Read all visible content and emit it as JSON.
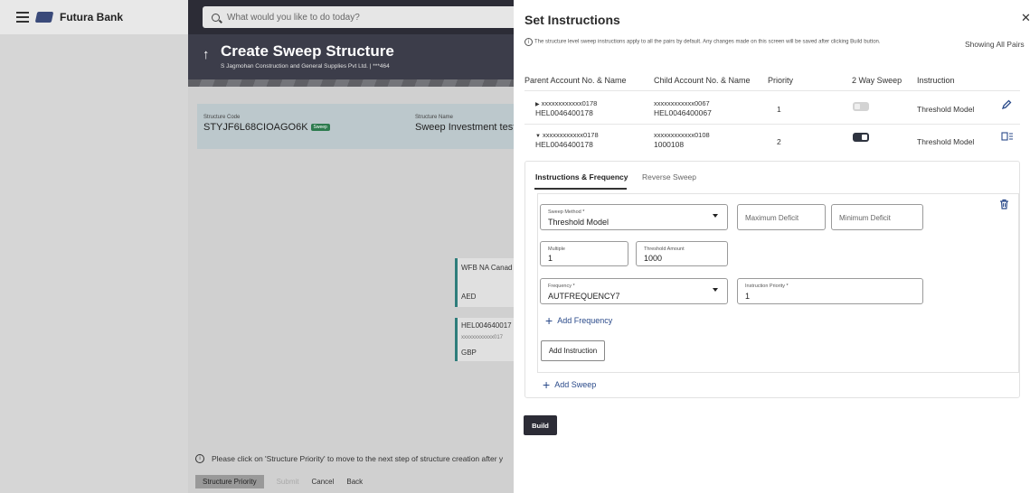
{
  "header": {
    "brand": "Futura Bank",
    "search_placeholder": "What would you like to do today?"
  },
  "page": {
    "title": "Create Sweep Structure",
    "subtitle": "S Jagmohan Construction and General Supplies Pvt Ltd. | ***464",
    "structure_code_label": "Structure Code",
    "structure_code": "STYJF6L68CIOAGO6K",
    "structure_code_badge": "Sweep",
    "structure_name_label": "Structure Name",
    "structure_name": "Sweep Investment test",
    "nodes": [
      {
        "line1": "WFB NA Canad",
        "line2": "AED"
      },
      {
        "line1": "HEL004640017",
        "line2": "xxxxxxxxxxxx017",
        "line3": "GBP"
      }
    ],
    "note": "Please click on 'Structure Priority' to move to the next step of structure creation after y",
    "buttons": {
      "structure_priority": "Structure Priority",
      "submit": "Submit",
      "cancel": "Cancel",
      "back": "Back"
    }
  },
  "drawer": {
    "title": "Set Instructions",
    "info": "The structure level sweep instructions apply to all the pairs by default. Any changes made on this screen will be saved after clicking Build button.",
    "showing": "Showing All Pairs",
    "columns": [
      "Parent Account No. & Name",
      "Child Account No. & Name",
      "Priority",
      "2 Way Sweep",
      "Instruction"
    ],
    "rows": [
      {
        "parent_acc": "xxxxxxxxxxxx0178",
        "parent_name": "HEL0046400178",
        "child_acc": "xxxxxxxxxxxx0067",
        "child_name": "HEL0046400067",
        "priority": "1",
        "two_way": false,
        "instruction": "Threshold Model",
        "expanded": false
      },
      {
        "parent_acc": "xxxxxxxxxxxx0178",
        "parent_name": "HEL0046400178",
        "child_acc": "xxxxxxxxxxxx0108",
        "child_name": "1000108",
        "priority": "2",
        "two_way": true,
        "instruction": "Threshold Model",
        "expanded": true
      }
    ],
    "tabs": [
      "Instructions & Frequency",
      "Reverse Sweep"
    ],
    "form": {
      "sweep_method_label": "Sweep Method",
      "sweep_method_value": "Threshold Model",
      "max_deficit_placeholder": "Maximum Deficit",
      "min_deficit_placeholder": "Minimum Deficit",
      "multiple_label": "Multiple",
      "multiple_value": "1",
      "threshold_label": "Threshold Amount",
      "threshold_value": "1000",
      "frequency_label": "Frequency",
      "frequency_value": "AUTFREQUENCY7",
      "instr_priority_label": "Instruction Priority",
      "instr_priority_value": "1",
      "required_mark": "*"
    },
    "add_frequency": "Add Frequency",
    "add_instruction": "Add Instruction",
    "add_sweep": "Add Sweep",
    "build": "Build"
  }
}
